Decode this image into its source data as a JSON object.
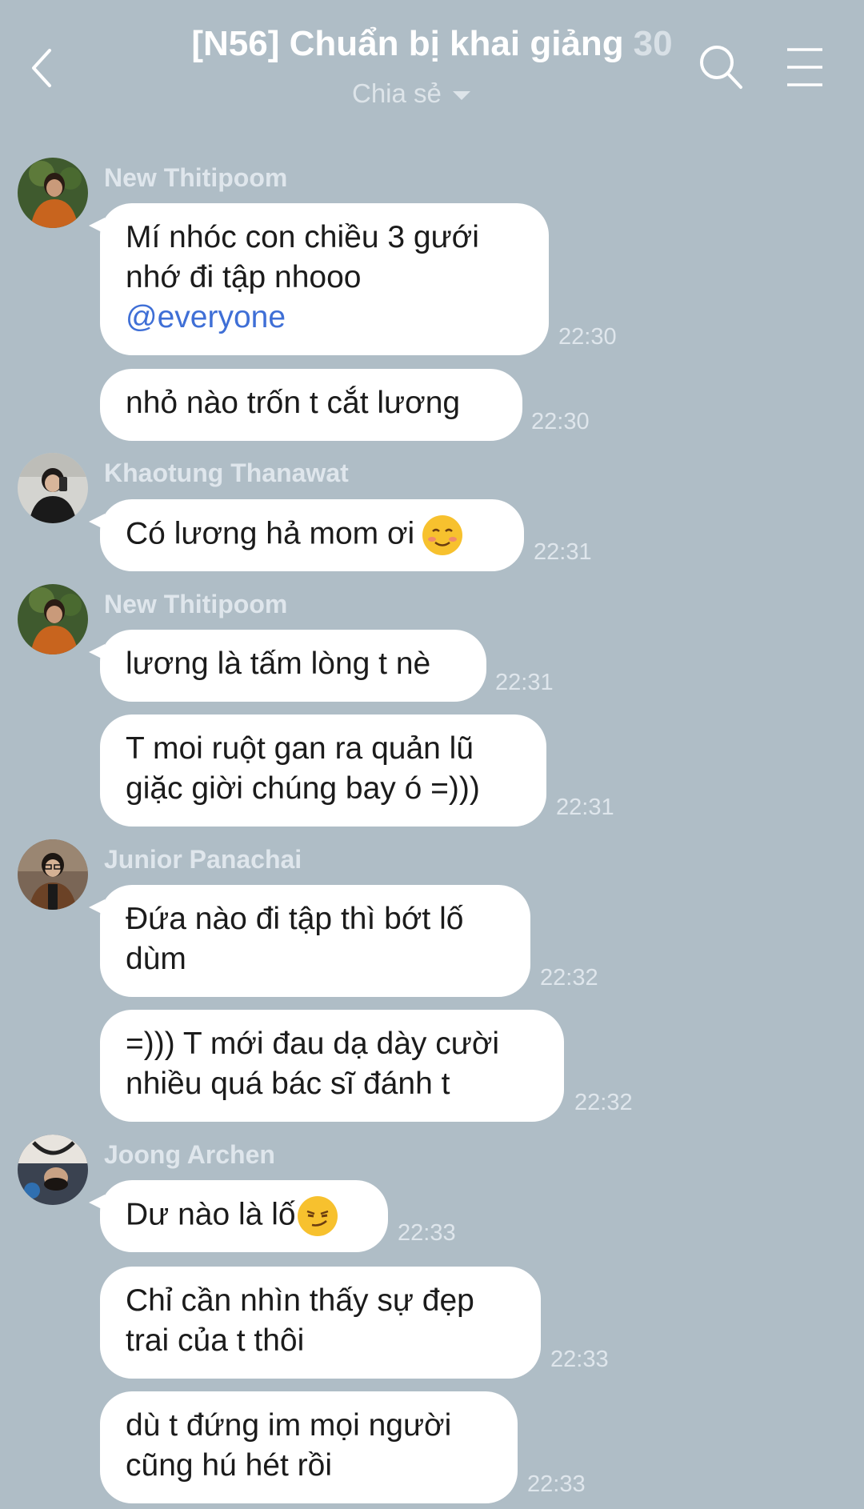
{
  "header": {
    "title": "[N56] Chuẩn bị khai giảng",
    "member_count": "30",
    "subtitle": "Chia sẻ",
    "icons": {
      "back": "chevron-left-icon",
      "search": "search-icon",
      "menu": "hamburger-menu-icon"
    }
  },
  "messages": [
    {
      "sender": "New Thitipoom",
      "avatar": "avatar-new-thitipoom",
      "lines": [
        "Mí nhóc con chiều 3 gưới",
        "nhớ đi tập nhooo"
      ],
      "mention": "@everyone",
      "time": "22:30"
    },
    {
      "lines": [
        "nhỏ nào trốn t cắt lương"
      ],
      "time": "22:30"
    },
    {
      "sender": "Khaotung Thanawat",
      "avatar": "avatar-khaotung-thanawat",
      "lines": [
        "Có lương hả mom ơi"
      ],
      "emoji": "smiling-blush-emoji",
      "time": "22:31"
    },
    {
      "sender": "New Thitipoom",
      "avatar": "avatar-new-thitipoom",
      "lines": [
        "lương là tấm lòng t nè"
      ],
      "time": "22:31"
    },
    {
      "lines": [
        "T moi ruột gan ra quản lũ",
        "giặc giời chúng bay ó =)))"
      ],
      "time": "22:31"
    },
    {
      "sender": "Junior Panachai",
      "avatar": "avatar-junior-panachai",
      "lines": [
        "Đứa nào đi tập thì bớt lố",
        "dùm"
      ],
      "time": "22:32"
    },
    {
      "lines": [
        "=))) T mới đau dạ dày cười",
        "nhiều quá bác sĩ đánh t"
      ],
      "time": "22:32"
    },
    {
      "sender": "Joong Archen",
      "avatar": "avatar-joong-archen",
      "lines": [
        "Dư nào là lố"
      ],
      "emoji": "smirk-emoji",
      "time": "22:33"
    },
    {
      "lines": [
        "Chỉ cần nhìn thấy sự đẹp",
        "trai của t thôi"
      ],
      "time": "22:33"
    },
    {
      "lines": [
        "dù t đứng im mọi người",
        "cũng hú hét rồi"
      ],
      "time": "22:33"
    }
  ]
}
